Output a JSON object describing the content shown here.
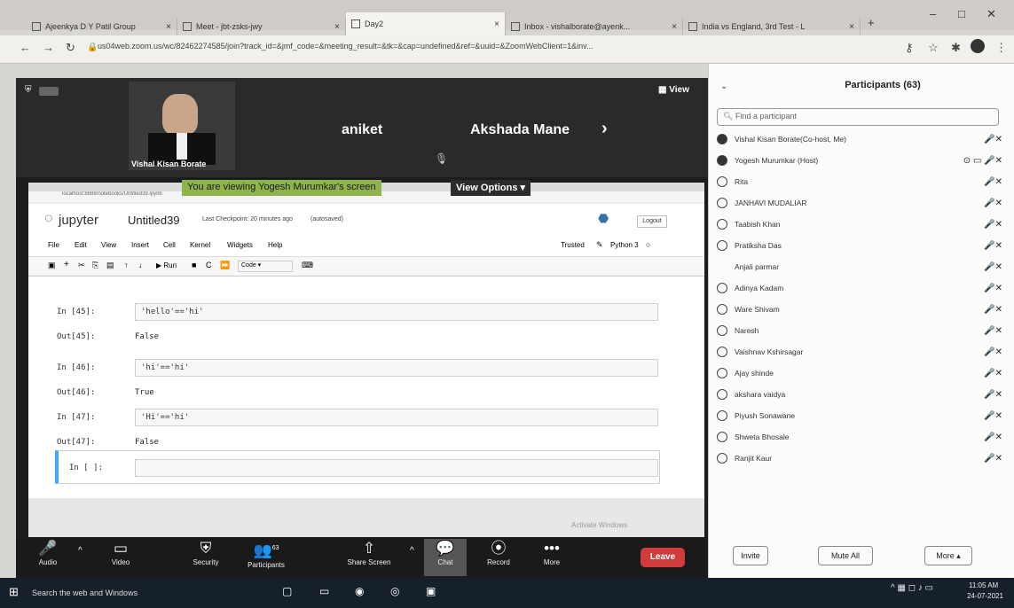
{
  "browser": {
    "tabs": [
      {
        "label": "Ajeenkya D Y Patil Group"
      },
      {
        "label": "Meet - jbt-zsks-jwy"
      },
      {
        "label": "Day2"
      },
      {
        "label": "Inbox - vishalborate@ayenk..."
      },
      {
        "label": "India vs England, 3rd Test - L"
      }
    ],
    "url": "us04web.zoom.us/wc/82462274585/join?track_id=&jmf_code=&meeting_result=&tk=&cap=undefined&ref=&uuid=&ZoomWebClient=1&inv..."
  },
  "meeting": {
    "gallery": {
      "speaker": "Vishal Kisan Borate",
      "name2": "aniket",
      "name3": "Akshada Mane",
      "view_label": "View"
    },
    "share_banner": "You are viewing Yogesh Murumkar's screen",
    "view_options": "View Options"
  },
  "jupyter": {
    "brand": "jupyter",
    "notebook": "Untitled39",
    "checkpoint": "Last Checkpoint: 20 minutes ago",
    "status": "(autosaved)",
    "logout": "Logout",
    "trusted": "Trusted",
    "kernel": "Python 3",
    "menu": [
      "File",
      "Edit",
      "View",
      "Insert",
      "Cell",
      "Kernel",
      "Widgets",
      "Help"
    ],
    "toolbar": {
      "run": "Run",
      "celltype": "Code"
    },
    "cells": [
      {
        "in_prompt": "In [45]:",
        "code": "'hello'=='hi'",
        "out_prompt": "Out[45]:",
        "output": "False"
      },
      {
        "in_prompt": "In [46]:",
        "code": "'hi'=='hi'",
        "out_prompt": "Out[46]:",
        "output": "True"
      },
      {
        "in_prompt": "In [47]:",
        "code": "'Hi'=='hi'",
        "out_prompt": "Out[47]:",
        "output": "False"
      }
    ],
    "empty_prompt": "In [ ]:",
    "activate": "Activate Windows"
  },
  "toolbar": {
    "audio": "Audio",
    "video": "Video",
    "security": "Security",
    "participants": "Participants",
    "participants_count": "63",
    "share": "Share Screen",
    "chat": "Chat",
    "record": "Record",
    "more": "More",
    "leave": "Leave"
  },
  "participants": {
    "title": "Participants (63)",
    "search_placeholder": "Find a participant",
    "list": [
      {
        "name": "Vishal Kisan Borate(Co-host, Me)"
      },
      {
        "name": "Yogesh Murumkar (Host)"
      },
      {
        "name": "Rita"
      },
      {
        "name": "JANHAVI MUDALIAR"
      },
      {
        "name": "Taabish Khan"
      },
      {
        "name": "Pratiksha Das"
      },
      {
        "name": "Anjali parmar"
      },
      {
        "name": "Adinya Kadam"
      },
      {
        "name": "Ware Shivam"
      },
      {
        "name": "Naresh"
      },
      {
        "name": "Vaishnav Kshirsagar"
      },
      {
        "name": "Ajay shinde"
      },
      {
        "name": "akshara vaidya"
      },
      {
        "name": "Piyush Sonawane"
      },
      {
        "name": "Shweta Bhosale"
      },
      {
        "name": "Ranjit Kaur"
      }
    ],
    "invite": "Invite",
    "mute_all": "Mute All",
    "more": "More"
  },
  "taskbar": {
    "search": "Search the web and Windows",
    "time": "11:05 AM",
    "date": "24-07-2021"
  }
}
